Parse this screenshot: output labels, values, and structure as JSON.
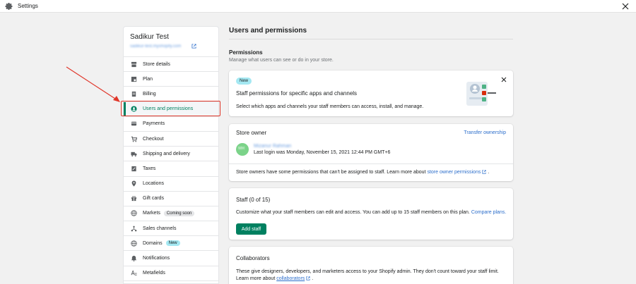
{
  "window": {
    "title": "Settings"
  },
  "sidebar": {
    "store_name": "Sadikur Test",
    "store_url": "sadikur-test.myshopify.com",
    "items": [
      {
        "label": "Store details",
        "icon": "store-icon"
      },
      {
        "label": "Plan",
        "icon": "plan-icon"
      },
      {
        "label": "Billing",
        "icon": "billing-icon"
      },
      {
        "label": "Users and permissions",
        "icon": "user-icon",
        "active": true
      },
      {
        "label": "Payments",
        "icon": "payments-icon"
      },
      {
        "label": "Checkout",
        "icon": "cart-icon"
      },
      {
        "label": "Shipping and delivery",
        "icon": "truck-icon"
      },
      {
        "label": "Taxes",
        "icon": "taxes-icon"
      },
      {
        "label": "Locations",
        "icon": "location-icon"
      },
      {
        "label": "Gift cards",
        "icon": "gift-icon"
      },
      {
        "label": "Markets",
        "icon": "globe-icon",
        "badge": "Coming soon"
      },
      {
        "label": "Sales channels",
        "icon": "channels-icon"
      },
      {
        "label": "Domains",
        "icon": "globe-icon",
        "badge": "New"
      },
      {
        "label": "Notifications",
        "icon": "bell-icon"
      },
      {
        "label": "Metafields",
        "icon": "metafields-icon"
      }
    ]
  },
  "main": {
    "page_title": "Users and permissions",
    "permissions": {
      "title": "Permissions",
      "subtitle": "Manage what users can see or do in your store."
    },
    "promo_card": {
      "badge": "New",
      "title": "Staff permissions for specific apps and channels",
      "description": "Select which apps and channels your staff members can access, install, and manage."
    },
    "owner_card": {
      "title": "Store owner",
      "transfer_link": "Transfer ownership",
      "avatar_initials": "MR",
      "owner_name": "Mizanur Rahman",
      "last_login": "Last login was Monday, November 15, 2021 12:44 PM GMT+6",
      "note_prefix": "Store owners have some permissions that can't be assigned to staff. Learn more about ",
      "note_link": "store owner permissions",
      "note_suffix": "."
    },
    "staff_card": {
      "title": "Staff (0 of 15)",
      "description_prefix": "Customize what your staff members can edit and access. You can add up to 15 staff members on this plan. ",
      "description_link": "Compare plans.",
      "button": "Add staff"
    },
    "collaborators_card": {
      "title": "Collaborators",
      "description_prefix": "These give designers, developers, and marketers access to your Shopify admin. They don't count toward your staff limit. Learn more about ",
      "description_link": "collaborators",
      "description_suffix": "."
    }
  },
  "colors": {
    "accent": "#008060",
    "link": "#2c6ecb",
    "highlight": "#e0362a",
    "badge_new": "#a4e8f2"
  }
}
